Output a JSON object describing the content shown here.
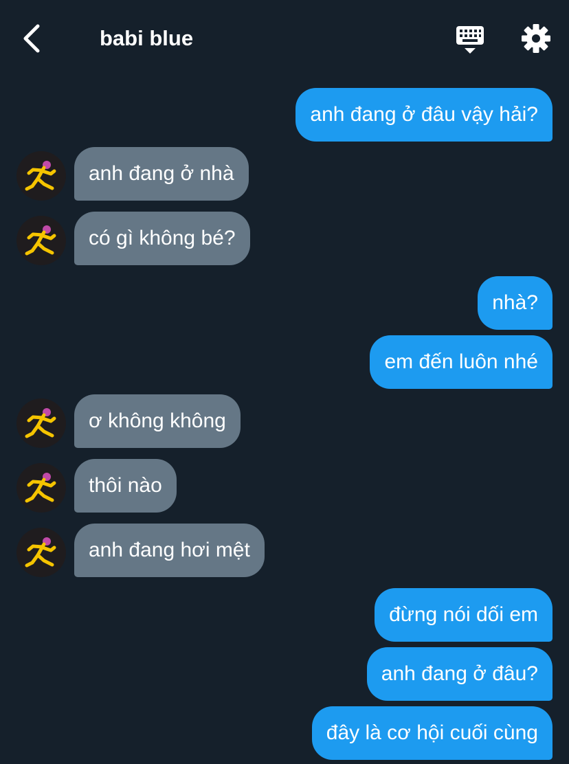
{
  "header": {
    "title": "babi blue",
    "back_icon": "chevron-left-icon",
    "keyboard_icon": "keyboard-icon",
    "settings_icon": "gear-icon"
  },
  "colors": {
    "background": "#15202b",
    "sent_bubble": "#1d9bf0",
    "received_bubble": "#657786",
    "text": "#ffffff",
    "avatar_figure": "#f5c400"
  },
  "messages": [
    {
      "from": "me",
      "text": "anh đang ở đâu vậy hải?"
    },
    {
      "from": "them",
      "text": "anh đang ở nhà"
    },
    {
      "from": "them",
      "text": "có gì không bé?"
    },
    {
      "from": "me",
      "text": "nhà?"
    },
    {
      "from": "me",
      "text": "em đến luôn nhé"
    },
    {
      "from": "them",
      "text": "ơ không không"
    },
    {
      "from": "them",
      "text": "thôi nào"
    },
    {
      "from": "them",
      "text": "anh đang hơi mệt"
    },
    {
      "from": "me",
      "text": "đừng nói dối em"
    },
    {
      "from": "me",
      "text": "anh đang ở đâu?"
    },
    {
      "from": "me",
      "text": "đây là cơ hội cuối cùng"
    }
  ]
}
